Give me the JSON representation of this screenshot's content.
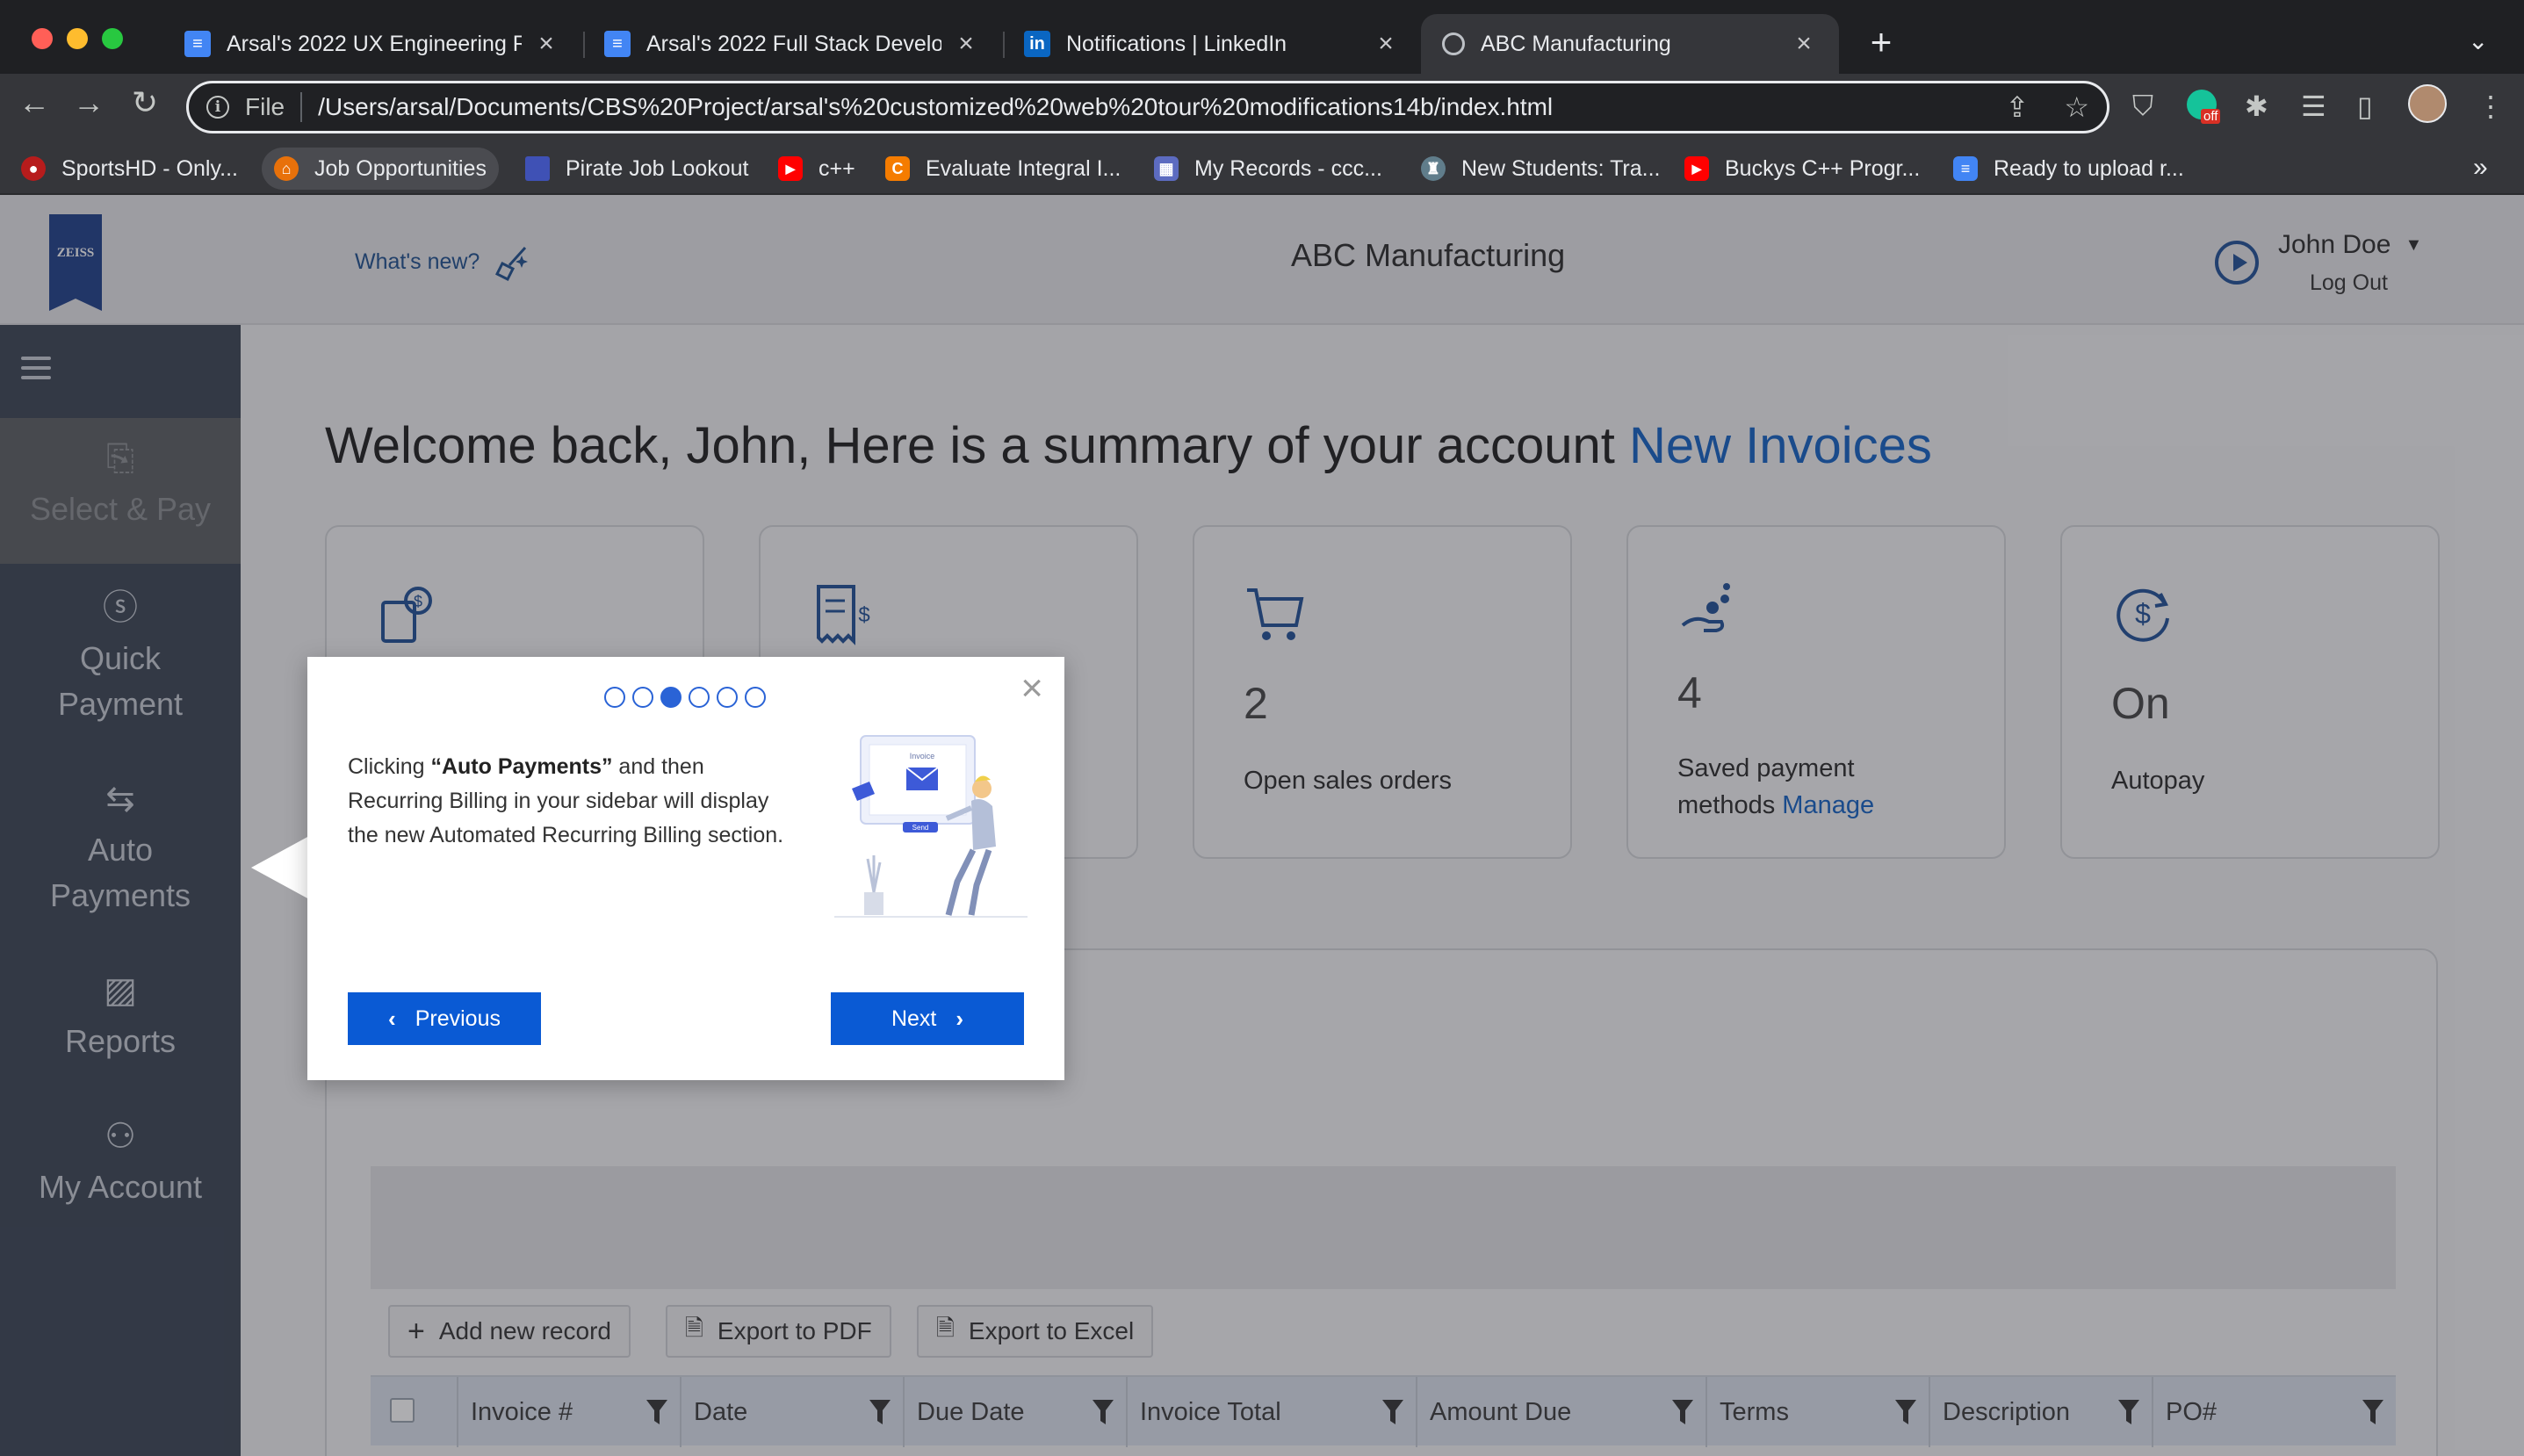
{
  "browser": {
    "tabs": [
      {
        "title": "Arsal's 2022 UX Engineering R",
        "icon": "google-docs-icon"
      },
      {
        "title": "Arsal's 2022 Full Stack Develop",
        "icon": "google-docs-icon"
      },
      {
        "title": "Notifications | LinkedIn",
        "icon": "linkedin-icon"
      },
      {
        "title": "ABC Manufacturing",
        "icon": "globe-icon"
      }
    ],
    "address_scheme": "File",
    "address_url": "/Users/arsal/Documents/CBS%20Project/arsal's%20customized%20web%20tour%20modifications14b/index.html",
    "bookmarks": [
      {
        "label": "SportsHD - Only...",
        "icon": "sports-icon",
        "color": "#b71c1c"
      },
      {
        "label": "Job Opportunities",
        "icon": "job-icon",
        "color": "#e8710a"
      },
      {
        "label": "Pirate Job Lookout",
        "icon": "bookmark-icon",
        "color": "#3f51b5"
      },
      {
        "label": "c++",
        "icon": "youtube-icon",
        "color": "#ff0000"
      },
      {
        "label": "Evaluate Integral I...",
        "icon": "calculator-icon",
        "color": "#f57c00"
      },
      {
        "label": "My Records - ccc...",
        "icon": "records-icon",
        "color": "#5c6bc0"
      },
      {
        "label": "New Students: Tra...",
        "icon": "school-icon",
        "color": "#607d8b"
      },
      {
        "label": "Buckys C++ Progr...",
        "icon": "youtube-icon",
        "color": "#ff0000"
      },
      {
        "label": "Ready to upload r...",
        "icon": "google-docs-icon",
        "color": "#4285f4"
      }
    ],
    "extension_badge": "off"
  },
  "header": {
    "whats_new": "What's new?",
    "app_title": "ABC Manufacturing",
    "user_name": "John Doe",
    "logout": "Log Out",
    "logo_text": "ZEISS"
  },
  "sidebar": {
    "items": [
      {
        "label": "Select & Pay",
        "icon": "select-pay-icon"
      },
      {
        "label": "Quick Payment",
        "icon": "dollar-circle-icon"
      },
      {
        "label": "Auto Payments",
        "icon": "transfer-arrows-icon"
      },
      {
        "label": "Reports",
        "icon": "chart-icon"
      },
      {
        "label": "My Account",
        "icon": "user-icon"
      }
    ]
  },
  "main": {
    "welcome": "Welcome back, John, Here is a summary of your account",
    "welcome_link": "New Invoices",
    "cards": [
      {
        "value": "",
        "label": "",
        "icon": "invoice-dollar-icon"
      },
      {
        "value": "",
        "label": "",
        "icon": "receipt-icon"
      },
      {
        "value": "2",
        "label": "Open sales orders",
        "icon": "cart-icon"
      },
      {
        "value": "4",
        "label": "Saved payment methods",
        "link": "Manage",
        "icon": "hand-coins-icon"
      },
      {
        "value": "On",
        "label": "Autopay",
        "icon": "recurring-dollar-icon"
      }
    ],
    "toolbar": {
      "add": "Add new record",
      "pdf": "Export to PDF",
      "excel": "Export to Excel"
    },
    "columns": [
      "Invoice #",
      "Date",
      "Due Date",
      "Invoice Total",
      "Amount Due",
      "Terms",
      "Description",
      "PO#"
    ]
  },
  "tour": {
    "step": 3,
    "total_steps": 6,
    "text_prefix": "Clicking ",
    "text_bold": "“Auto Payments”",
    "text_suffix": " and then Recurring Billing in your sidebar will display the new Automated Recurring Billing section.",
    "prev_label": "Previous",
    "next_label": "Next",
    "illustration_labels": [
      "Invoice",
      "Send"
    ]
  },
  "colors": {
    "accent": "#0a5ad4",
    "link": "#1361c4",
    "sidebar": "#3a4453"
  }
}
